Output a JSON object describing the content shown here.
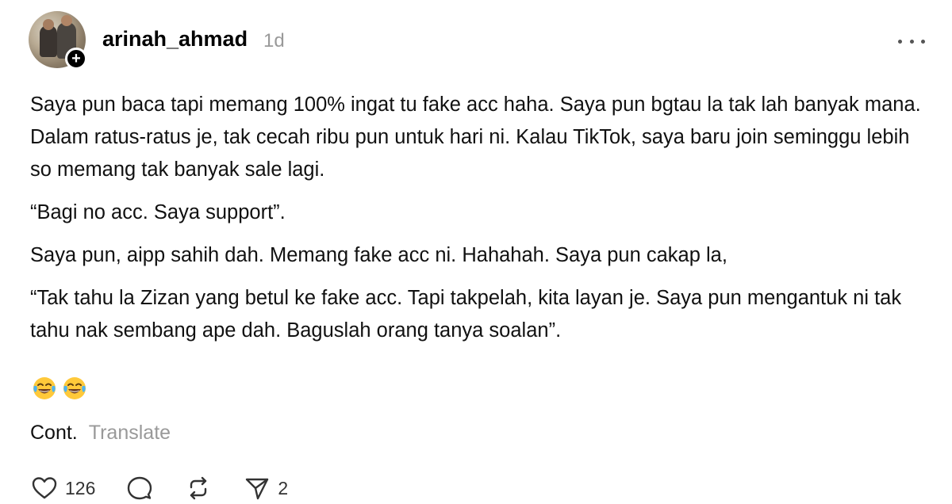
{
  "post": {
    "author": {
      "username": "arinah_ahmad",
      "timestamp": "1d",
      "follow_icon": "plus"
    },
    "paragraphs": [
      "Saya pun baca tapi memang 100% ingat tu fake acc haha. Saya pun bgtau la tak lah banyak mana. Dalam ratus-ratus je, tak cecah ribu pun untuk hari ni. Kalau TikTok, saya baru join seminggu lebih so memang tak banyak sale lagi.",
      "“Bagi no acc. Saya support”.",
      "Saya pun, aipp sahih dah. Memang fake acc ni. Hahahah. Saya pun cakap la,",
      "“Tak tahu la Zizan yang betul ke fake acc. Tapi takpelah, kita layan je. Saya pun mengantuk ni tak tahu nak sembang ape dah. Baguslah orang tanya soalan”."
    ],
    "emojis": [
      "face-with-tears-of-joy",
      "face-with-tears-of-joy"
    ],
    "cont_label": "Cont.",
    "translate_label": "Translate",
    "actions": {
      "like": {
        "icon": "heart-icon",
        "count": "126"
      },
      "reply": {
        "icon": "comment-icon"
      },
      "repost": {
        "icon": "repost-icon"
      },
      "share": {
        "icon": "send-icon",
        "count": "2"
      }
    }
  },
  "colors": {
    "text": "#111111",
    "muted": "#999999",
    "icon": "#333333"
  }
}
